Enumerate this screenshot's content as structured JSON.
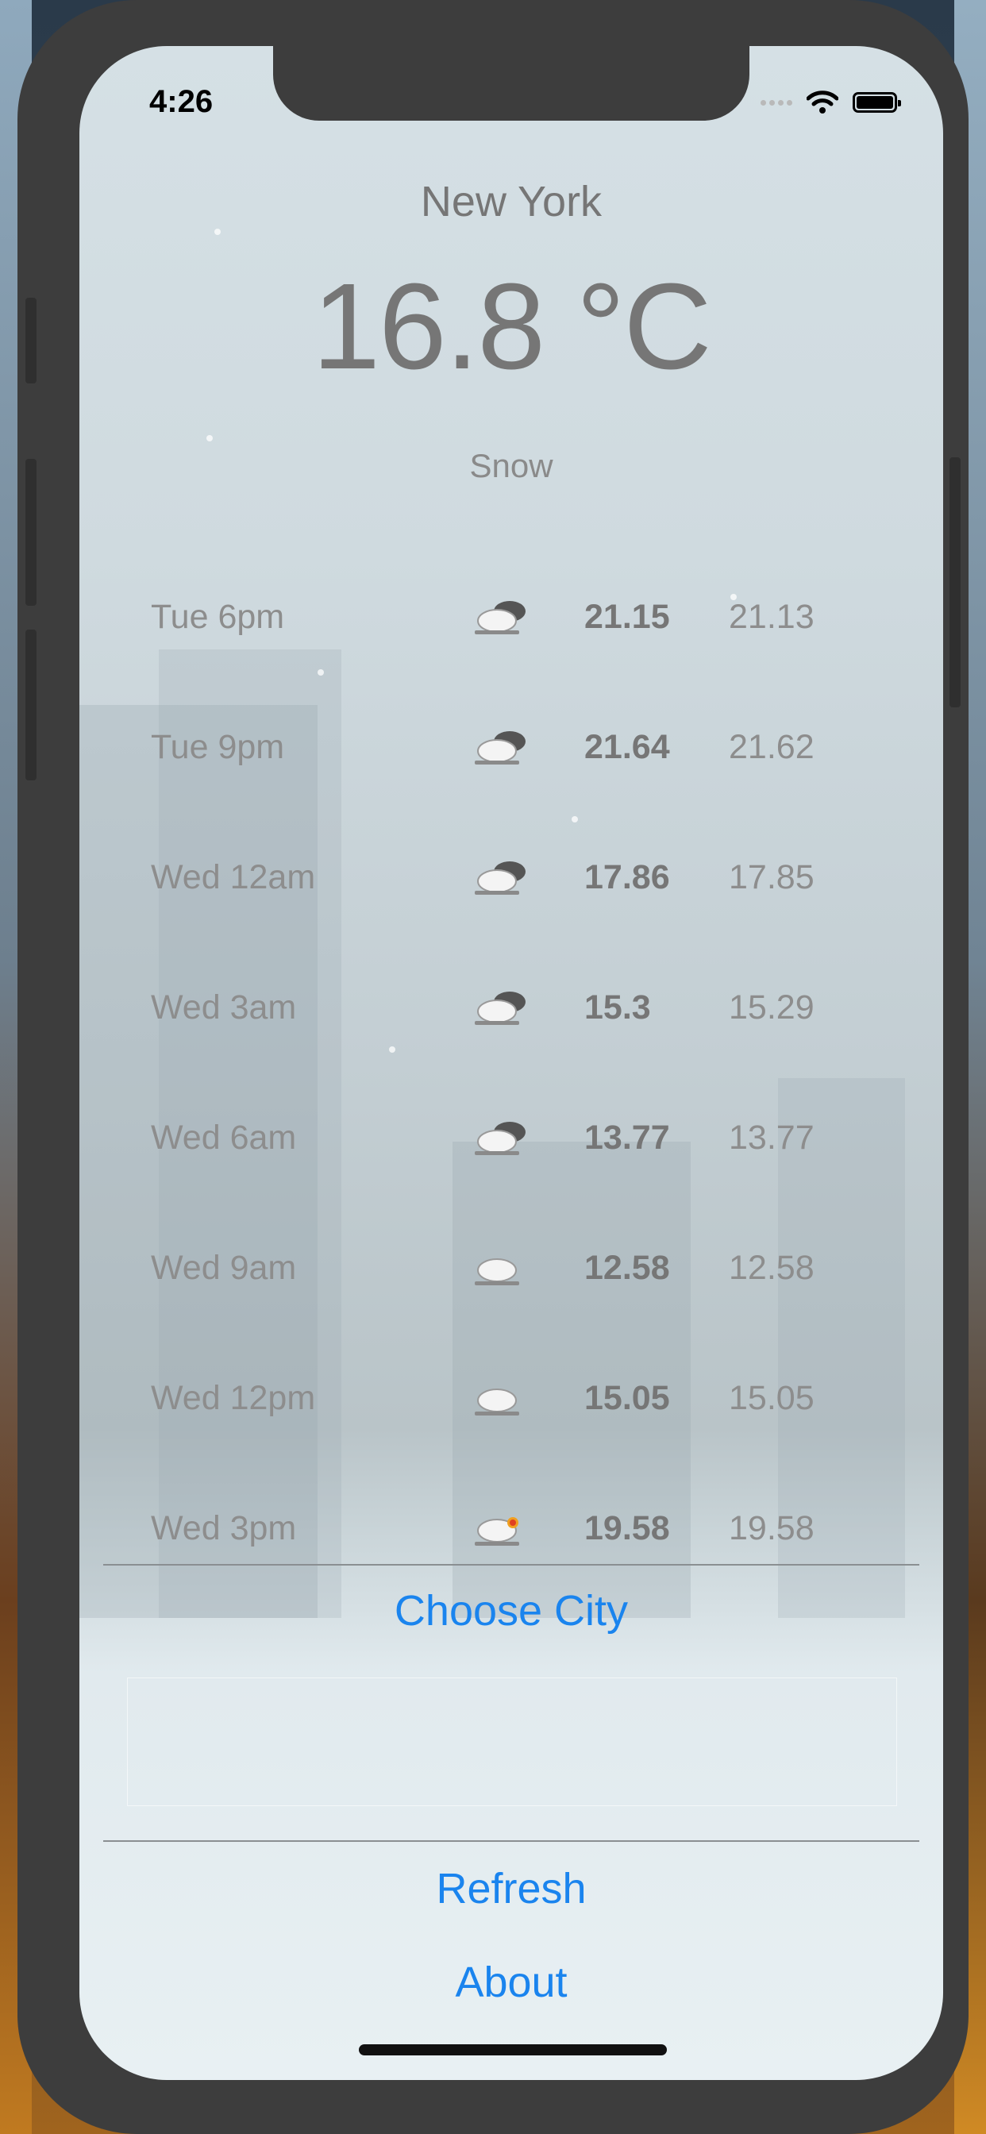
{
  "status_bar": {
    "time": "4:26"
  },
  "weather": {
    "city": "New York",
    "temperature": "16.8 °C",
    "condition": "Snow"
  },
  "forecast": [
    {
      "time": "Tue 6pm",
      "icon": "snow-cloud-icon",
      "high": "21.15",
      "low": "21.13"
    },
    {
      "time": "Tue 9pm",
      "icon": "snow-cloud-icon",
      "high": "21.64",
      "low": "21.62"
    },
    {
      "time": "Wed 12am",
      "icon": "snow-cloud-icon",
      "high": "17.86",
      "low": "17.85"
    },
    {
      "time": "Wed 3am",
      "icon": "snow-cloud-icon",
      "high": "15.3",
      "low": "15.29"
    },
    {
      "time": "Wed 6am",
      "icon": "snow-cloud-icon",
      "high": "13.77",
      "low": "13.77"
    },
    {
      "time": "Wed 9am",
      "icon": "light-snow-icon",
      "high": "12.58",
      "low": "12.58"
    },
    {
      "time": "Wed 12pm",
      "icon": "light-snow-icon",
      "high": "15.05",
      "low": "15.05"
    },
    {
      "time": "Wed 3pm",
      "icon": "sun-snow-icon",
      "high": "19.58",
      "low": "19.58"
    }
  ],
  "actions": {
    "choose_city": "Choose City",
    "refresh": "Refresh",
    "about": "About"
  },
  "colors": {
    "accent": "#1a84ee",
    "text": "#767676"
  }
}
